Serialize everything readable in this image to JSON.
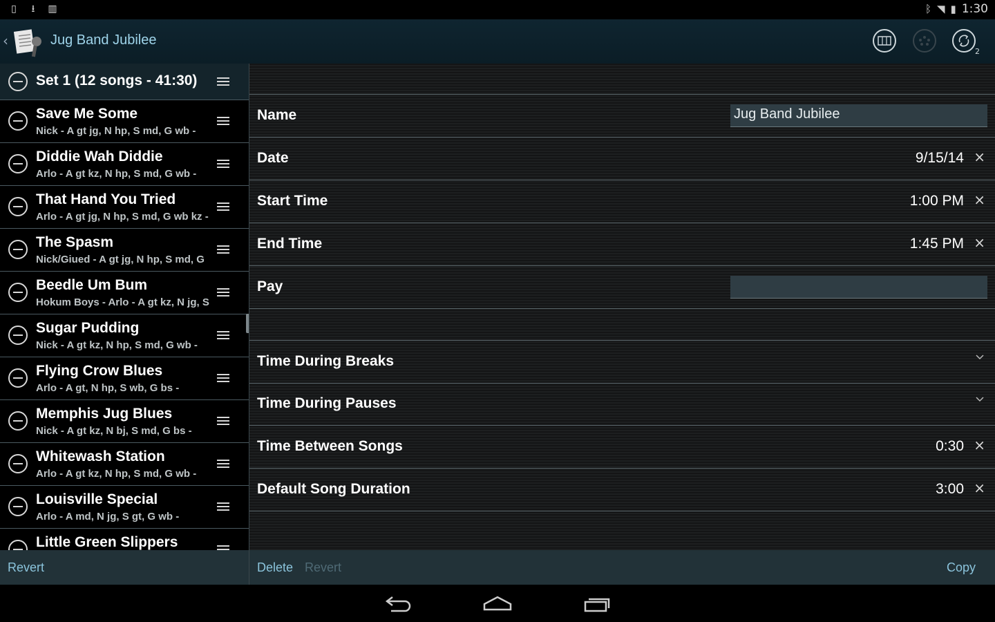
{
  "status_bar": {
    "time": "1:30",
    "left_icons": [
      "sim-icon",
      "download-icon",
      "barcode-icon"
    ],
    "right_icons": [
      "bluetooth-icon",
      "wifi-icon",
      "battery-icon"
    ]
  },
  "action_bar": {
    "title": "Jug Band Jubilee",
    "actions": [
      "layout-icon",
      "midi-icon",
      "sync-icon"
    ],
    "sync_badge": "2"
  },
  "set_list": {
    "header": "Set 1 (12 songs - 41:30)",
    "songs": [
      {
        "title": "Save Me Some",
        "subtitle": "Nick - A gt jg, N hp, S md, G wb -"
      },
      {
        "title": "Diddie Wah Diddie",
        "subtitle": "Arlo - A gt kz, N hp, S md, G wb -"
      },
      {
        "title": "That Hand You Tried",
        "subtitle": "Arlo - A gt jg, N hp, S md, G wb kz -"
      },
      {
        "title": "The Spasm",
        "subtitle": "Nick/Giued - A gt jg, N hp, S md, G"
      },
      {
        "title": "Beedle Um Bum",
        "subtitle": "Hokum Boys - Arlo - A gt kz, N jg, S"
      },
      {
        "title": "Sugar Pudding",
        "subtitle": "Nick - A gt kz, N hp, S md, G wb -"
      },
      {
        "title": "Flying Crow Blues",
        "subtitle": "Arlo - A gt, N hp, S wb, G bs -"
      },
      {
        "title": "Memphis Jug Blues",
        "subtitle": "Nick - A gt kz, N bj, S md, G bs -"
      },
      {
        "title": "Whitewash Station",
        "subtitle": "Arlo - A gt kz, N hp, S md, G wb -"
      },
      {
        "title": "Louisville Special",
        "subtitle": "Arlo - A md, N jg, S gt, G wb -"
      },
      {
        "title": "Little Green Slippers",
        "subtitle": ""
      }
    ]
  },
  "details": {
    "name_label": "Name",
    "name_value": "Jug Band Jubilee",
    "date_label": "Date",
    "date_value": "9/15/14",
    "start_label": "Start Time",
    "start_value": "1:00 PM",
    "end_label": "End Time",
    "end_value": "1:45 PM",
    "pay_label": "Pay",
    "pay_value": "",
    "breaks_label": "Time During Breaks",
    "pauses_label": "Time During Pauses",
    "between_label": "Time Between Songs",
    "between_value": "0:30",
    "duration_label": "Default Song Duration",
    "duration_value": "3:00",
    "clear_glyph": "×"
  },
  "bottom_left": {
    "revert": "Revert"
  },
  "bottom_right": {
    "delete": "Delete",
    "revert": "Revert",
    "copy": "Copy"
  },
  "nav_bar": [
    "back-icon",
    "home-icon",
    "recents-icon"
  ]
}
